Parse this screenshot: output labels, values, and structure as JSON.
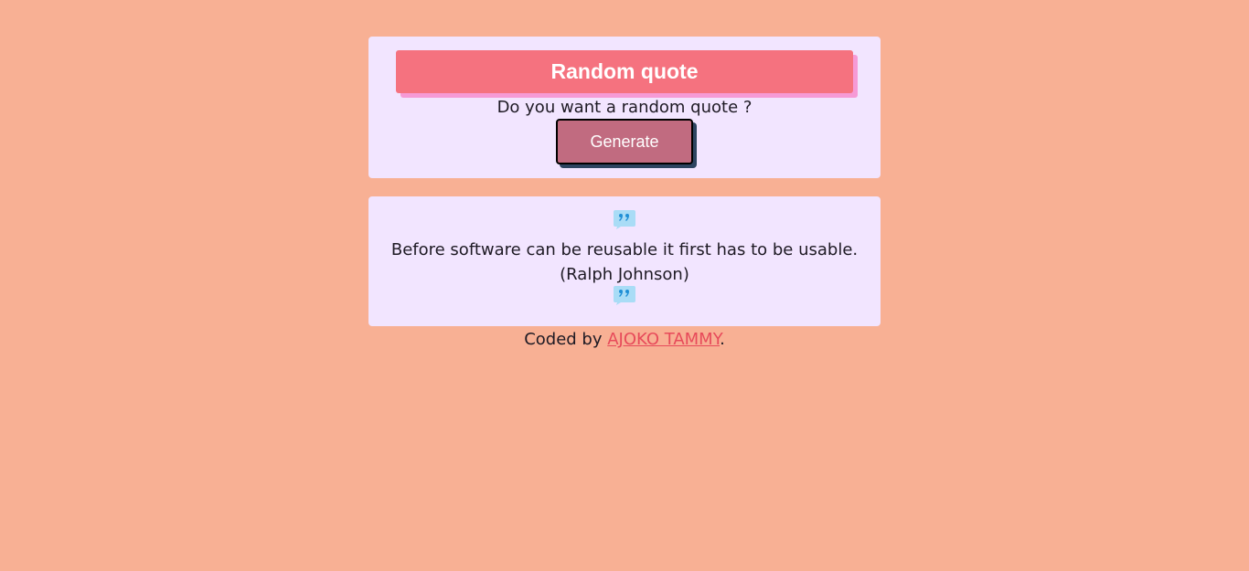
{
  "header": {
    "title": "Random quote",
    "question": "Do you want a random quote ?",
    "generate_label": "Generate"
  },
  "quote": {
    "icon": "quote-icon",
    "text": "Before software can be reusable it first has to be usable.",
    "author": "(Ralph Johnson)"
  },
  "footer": {
    "prefix": "Coded by ",
    "link_text": "AJOKO TAMMY",
    "suffix": "."
  },
  "colors": {
    "background": "#f8b094",
    "card": "#f2e5ff",
    "title_bar": "#f5727f",
    "button": "#c16b80",
    "link": "#e74a5a",
    "icon": "#35a8e8"
  }
}
